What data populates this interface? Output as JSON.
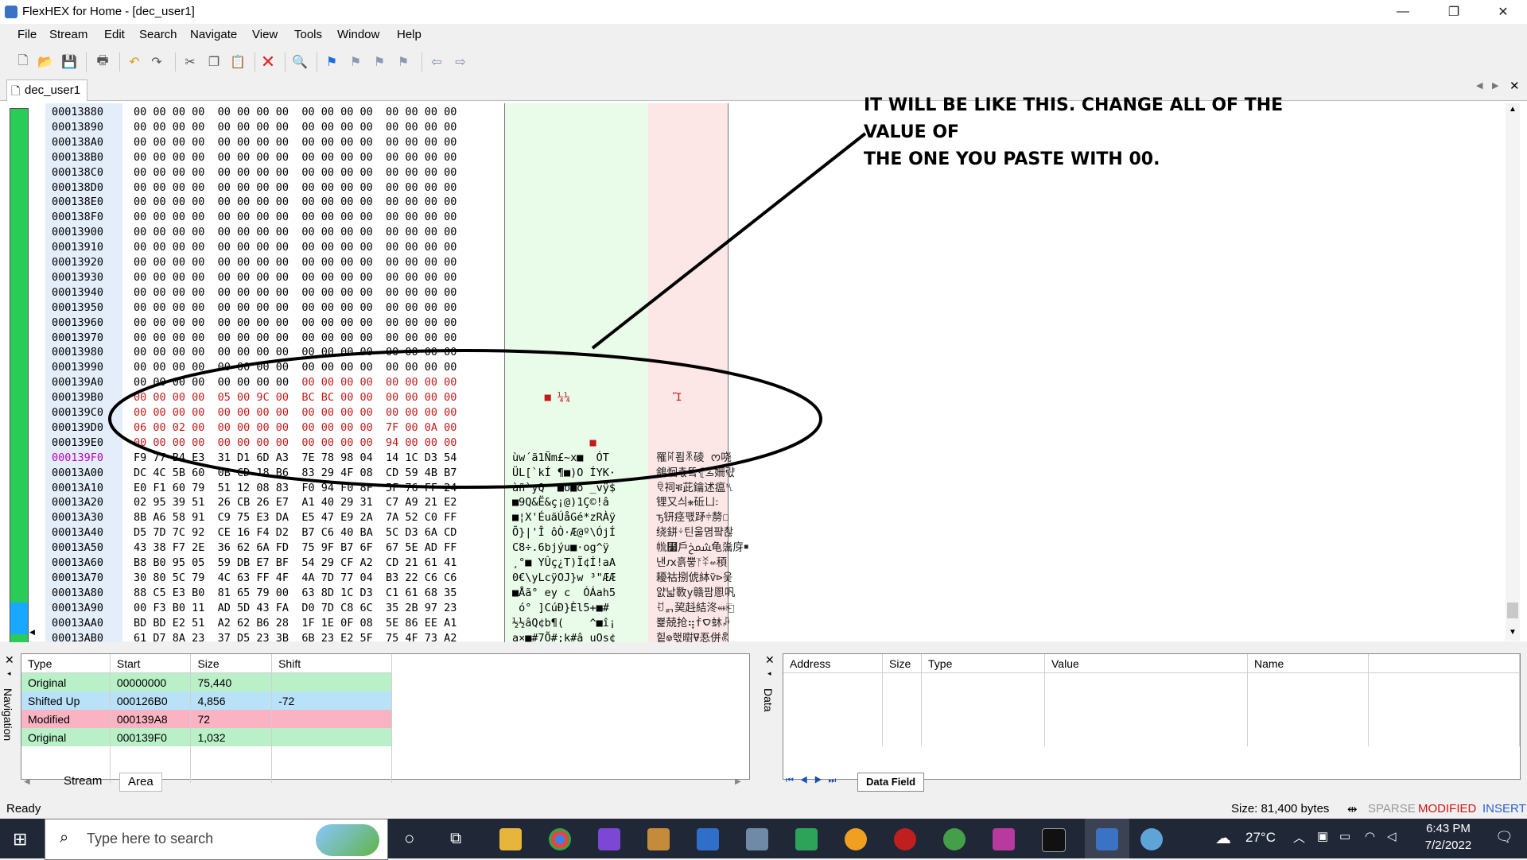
{
  "window": {
    "title": "FlexHEX for Home - [dec_user1]",
    "minimize_glyph": "—",
    "restore_glyph": "❐",
    "close_glyph": "✕"
  },
  "menu": [
    "File",
    "Stream",
    "Edit",
    "Search",
    "Navigate",
    "View",
    "Tools",
    "Window",
    "Help"
  ],
  "toolbar_icons": [
    "new-file-icon",
    "open-folder-icon",
    "save-icon",
    "print-icon",
    "undo-icon",
    "redo-icon",
    "cut-icon",
    "copy-icon",
    "paste-icon",
    "delete-icon",
    "find-icon",
    "bookmark-icon",
    "bookmark-prev-icon",
    "bookmark-next-icon",
    "bookmark-clear-icon",
    "back-arrow-icon",
    "forward-arrow-icon"
  ],
  "doc_tab": {
    "label": "dec_user1"
  },
  "annotation": {
    "line1": "IT WILL BE LIKE THIS. CHANGE ALL OF THE VALUE OF",
    "line2": "THE ONE YOU PASTE WITH 00."
  },
  "hex_rows": [
    {
      "addr": "00013880",
      "hex": "00 00 00 00  00 00 00 00  00 00 00 00  00 00 00 00",
      "ascii": "",
      "uni": "",
      "mod": false
    },
    {
      "addr": "00013890",
      "hex": "00 00 00 00  00 00 00 00  00 00 00 00  00 00 00 00",
      "ascii": "",
      "uni": "",
      "mod": false
    },
    {
      "addr": "000138A0",
      "hex": "00 00 00 00  00 00 00 00  00 00 00 00  00 00 00 00",
      "ascii": "",
      "uni": "",
      "mod": false
    },
    {
      "addr": "000138B0",
      "hex": "00 00 00 00  00 00 00 00  00 00 00 00  00 00 00 00",
      "ascii": "",
      "uni": "",
      "mod": false
    },
    {
      "addr": "000138C0",
      "hex": "00 00 00 00  00 00 00 00  00 00 00 00  00 00 00 00",
      "ascii": "",
      "uni": "",
      "mod": false
    },
    {
      "addr": "000138D0",
      "hex": "00 00 00 00  00 00 00 00  00 00 00 00  00 00 00 00",
      "ascii": "",
      "uni": "",
      "mod": false
    },
    {
      "addr": "000138E0",
      "hex": "00 00 00 00  00 00 00 00  00 00 00 00  00 00 00 00",
      "ascii": "",
      "uni": "",
      "mod": false
    },
    {
      "addr": "000138F0",
      "hex": "00 00 00 00  00 00 00 00  00 00 00 00  00 00 00 00",
      "ascii": "",
      "uni": "",
      "mod": false
    },
    {
      "addr": "00013900",
      "hex": "00 00 00 00  00 00 00 00  00 00 00 00  00 00 00 00",
      "ascii": "",
      "uni": "",
      "mod": false
    },
    {
      "addr": "00013910",
      "hex": "00 00 00 00  00 00 00 00  00 00 00 00  00 00 00 00",
      "ascii": "",
      "uni": "",
      "mod": false
    },
    {
      "addr": "00013920",
      "hex": "00 00 00 00  00 00 00 00  00 00 00 00  00 00 00 00",
      "ascii": "",
      "uni": "",
      "mod": false
    },
    {
      "addr": "00013930",
      "hex": "00 00 00 00  00 00 00 00  00 00 00 00  00 00 00 00",
      "ascii": "",
      "uni": "",
      "mod": false
    },
    {
      "addr": "00013940",
      "hex": "00 00 00 00  00 00 00 00  00 00 00 00  00 00 00 00",
      "ascii": "",
      "uni": "",
      "mod": false
    },
    {
      "addr": "00013950",
      "hex": "00 00 00 00  00 00 00 00  00 00 00 00  00 00 00 00",
      "ascii": "",
      "uni": "",
      "mod": false
    },
    {
      "addr": "00013960",
      "hex": "00 00 00 00  00 00 00 00  00 00 00 00  00 00 00 00",
      "ascii": "",
      "uni": "",
      "mod": false
    },
    {
      "addr": "00013970",
      "hex": "00 00 00 00  00 00 00 00  00 00 00 00  00 00 00 00",
      "ascii": "",
      "uni": "",
      "mod": false
    },
    {
      "addr": "00013980",
      "hex": "00 00 00 00  00 00 00 00  00 00 00 00  00 00 00 00",
      "ascii": "",
      "uni": "",
      "mod": false
    },
    {
      "addr": "00013990",
      "hex": "00 00 00 00  00 00 00 00  00 00 00 00  00 00 00 00",
      "ascii": "",
      "uni": "",
      "mod": false
    },
    {
      "addr": "000139A0",
      "hex": "00 00 00 00  00 00 00 00  00 00 00 00  00 00 00 00",
      "ascii": "",
      "uni": "",
      "mod": "partial"
    },
    {
      "addr": "000139B0",
      "hex": "00 00 00 00  05 00 9C 00  BC BC 00 00  00 00 00 00",
      "ascii": "     ■ ¼¼",
      "uni": "   Ἴ",
      "mod": true
    },
    {
      "addr": "000139C0",
      "hex": "00 00 00 00  00 00 00 00  00 00 00 00  00 00 00 00",
      "ascii": "",
      "uni": "",
      "mod": true
    },
    {
      "addr": "000139D0",
      "hex": "06 00 02 00  00 00 00 00  00 00 00 00  7F 00 0A 00",
      "ascii": "",
      "uni": "",
      "mod": true
    },
    {
      "addr": "000139E0",
      "hex": "00 00 00 00  00 00 00 00  00 00 00 00  94 00 00 00",
      "ascii": "            ■",
      "uni": "",
      "mod": true
    },
    {
      "addr": "000139F0",
      "hex": "F9 77 B4 E3  31 D1 6D A3  7E 78 98 04  14 1C D3 54",
      "ascii": "ùw´ã1Ñm£~x■  ÓT",
      "uni": "罹ꌸ푑ꍭ碐 ᰔ哓",
      "mod": false
    },
    {
      "addr": "00013A00",
      "hex": "DC 4C 5B 60  0B CD 18 B6  83 29 4F 08  CD 59 4B B7",
      "ascii": "ÜL[`kÍ ¶■)O ÍYK·",
      "uni": "䳜恛촋뚘⦃ࡏ姍랷",
      "mod": false
    },
    {
      "addr": "00013A10",
      "hex": "E0 F1 60 79  51 12 08 83  F0 94 F0 8F  5F 76 FF 24",
      "ascii": "àñ`yQ  ■ð■ð _vÿ$",
      "uni": "ꋠ祠ቑ茈鑰述瘟␤",
      "mod": false
    },
    {
      "addr": "00013A20",
      "hex": "02 95 39 51  26 CB 26 E7  A1 40 29 31  C7 A9 21 E2",
      "ascii": "■9Q&Ë&ç¡@)1Ç©!â",
      "uni": "锂又싀❋䂡ㄩ꧇",
      "mod": false
    },
    {
      "addr": "00013A30",
      "hex": "8B A6 58 91  C9 75 E3 DA  E5 47 E9 2A  7A 52 C0 FF",
      "ascii": "■¦X'ÉuãÚåGé*zRÀÿ",
      "uni": "ꚋ钘痉퍣䟥⫩剺￀",
      "mod": false
    },
    {
      "addr": "00013A40",
      "hex": "D5 7D 7C 92  CE 16 F4 D2  B7 C6 40 BA  5C D3 6A CD",
      "ascii": "Õ}|'Î ôÒ·Æ@º\\ÓjÍ",
      "uni": "绕鉼ᛎ틴울몀퍜촪",
      "mod": false
    },
    {
      "addr": "00013A50",
      "hex": "43 38 F7 2E  36 62 6A FD  75 9F B7 6F  67 5E AD FF",
      "ascii": "C8÷.6bjýu■·og^­ÿ",
      "uni": "㡃⻷戶ﵪ龟濷庌￭",
      "mod": false
    },
    {
      "addr": "00013A60",
      "hex": "B8 B0 95 05  59 DB E7 BF  54 29 CF A2  CD 21 61 41",
      "ascii": "¸°■ YÛç¿T)Ï¢Í!aA",
      "uni": "낸ԕ흙뿧⥔ꋏ⇍䅡",
      "mod": false
    },
    {
      "addr": "00013A70",
      "hex": "30 80 5C 79  4C 63 FF 4F  4A 7D 77 04  B3 22 C6 C6",
      "ascii": "0€\\yLcÿOJ}w ³\"ÆÆ",
      "uni": "耰祜捌俿絊ѷ⊳웆",
      "mod": false
    },
    {
      "addr": "00013A80",
      "hex": "88 C5 E3 B0  81 65 79 00  63 8D 1C D3  C1 61 68 35",
      "ascii": "■Åã° ey c  ÓÁah5",
      "uni": "얈낣斁y赣팜慁㕨",
      "mod": false
    },
    {
      "addr": "00013A90",
      "hex": "00 F3 B0 11  AD 5D 43 FA  D0 7D C8 6C  35 2B 97 23",
      "ascii": " ó° ]CúÐ}Èl5+■#",
      "uni": "ꀀᆰ巭﨣結泈⬵⎗",
      "mod": false
    },
    {
      "addr": "00013AA0",
      "hex": "BD BD E2 51  A2 62 B6 28  1F 1E 0F 08  5E 86 EE A1",
      "ascii": "½½âQ¢b¶(    ^■î¡",
      "uni": "뾽兢抢⢶ḟࠏ蚞ꇮ",
      "mod": false
    },
    {
      "addr": "00013AB0",
      "hex": "61 D7 8A 23  37 D5 23 3B  6B 23 E2 5F  75 4F 73 A2",
      "ascii": "a×■#7Õ#;k#â_uOs¢",
      "uni": "힡⎊핷㬣⍫忢併ꉳ",
      "mod": false
    }
  ],
  "nav_panel": {
    "label": "Navigation",
    "columns": [
      "Type",
      "Start",
      "Size",
      "Shift"
    ],
    "rows": [
      {
        "type": "Original",
        "start": "00000000",
        "size": "75,440",
        "shift": "",
        "color": "#b9f0c8"
      },
      {
        "type": "Shifted Up",
        "start": "000126B0",
        "size": "4,856",
        "shift": "-72",
        "color": "#b9e1f7"
      },
      {
        "type": "Modified",
        "start": "000139A8",
        "size": "72",
        "shift": "",
        "color": "#f9b3c3"
      },
      {
        "type": "Original",
        "start": "000139F0",
        "size": "1,032",
        "shift": "",
        "color": "#b9f0c8"
      }
    ],
    "tabs": [
      "Stream",
      "Area"
    ]
  },
  "data_panel": {
    "label": "Data",
    "columns": [
      "Address",
      "Size",
      "Type",
      "Value",
      "Name"
    ],
    "tab": "Data Field"
  },
  "status": {
    "left": "Ready",
    "size": "Size: 81,400 bytes",
    "sparse": "SPARSE",
    "modified": "MODIFIED",
    "insert": "INSERT"
  },
  "taskbar": {
    "search_placeholder": "Type here to search",
    "temperature": "27°C",
    "time": "6:43 PM",
    "date": "7/2/2022"
  }
}
